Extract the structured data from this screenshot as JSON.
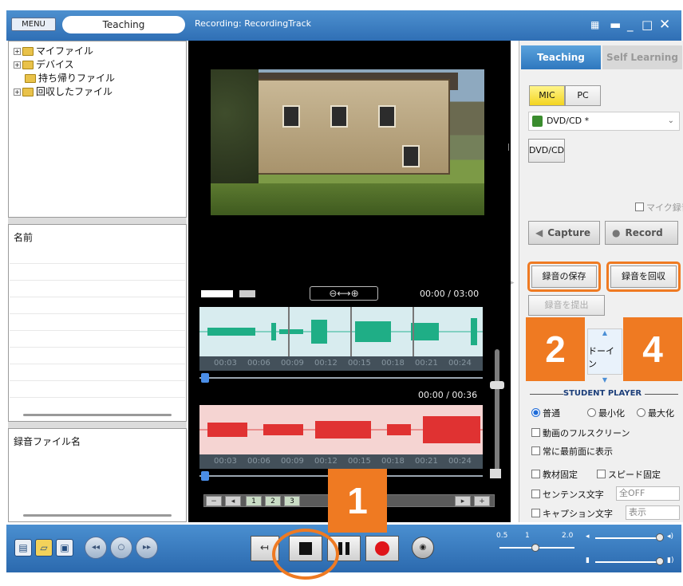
{
  "titlebar": {
    "menu_label": "MENU",
    "mode": "Teaching",
    "recording_title": "Recording: RecordingTrack",
    "controls": [
      "grid-icon",
      "minimize-icon",
      "underscore-icon",
      "maximize-icon",
      "close-icon"
    ]
  },
  "tree": {
    "items": [
      {
        "label": "マイファイル",
        "expandable": true
      },
      {
        "label": "デバイス",
        "expandable": true
      },
      {
        "label": "持ち帰りファイル",
        "expandable": false
      },
      {
        "label": "回収したファイル",
        "expandable": true
      }
    ]
  },
  "name_panel": {
    "header": "名前"
  },
  "recfile_panel": {
    "header": "録音ファイル名"
  },
  "waveform": {
    "time_top": "00:00 / 03:00",
    "time_bottom": "00:00 / 00:36",
    "ticks": [
      "00:03",
      "00:06",
      "00:09",
      "00:12",
      "00:15",
      "00:18",
      "00:21",
      "00:24"
    ],
    "pages": [
      "1",
      "2",
      "3"
    ]
  },
  "right": {
    "tab_active": "Teaching",
    "tab_inactive": "Self Learning",
    "mic_label": "MIC",
    "pc_label": "PC",
    "source": "DVD/CD *",
    "dvd_button": "DVD/CD",
    "mic_record_label": "マイク録音",
    "capture_label": "Capture",
    "record_label": "Record",
    "save_recording": "録音の保存",
    "collect_recording": "録音を回収",
    "submit_recording": "録音を提出",
    "mode_text": "ドーイン",
    "section_title": "STUDENT PLAYER",
    "radio_normal": "普通",
    "radio_min": "最小化",
    "radio_max": "最大化",
    "fullscreen": "動画のフルスクリーン",
    "always_top": "常に最前面に表示",
    "fix_material": "教材固定",
    "fix_speed": "スピード固定",
    "sentence_text": "センテンス文字",
    "sentence_value": "全OFF",
    "caption_text": "キャプション文字",
    "caption_value": "表示"
  },
  "annotations": {
    "badge1": "1",
    "badge2": "2",
    "badge4": "4",
    "accent": "#ef7a22"
  },
  "bottombar": {
    "speed_min": "0.5",
    "speed_mid": "1",
    "speed_max": "2.0"
  }
}
